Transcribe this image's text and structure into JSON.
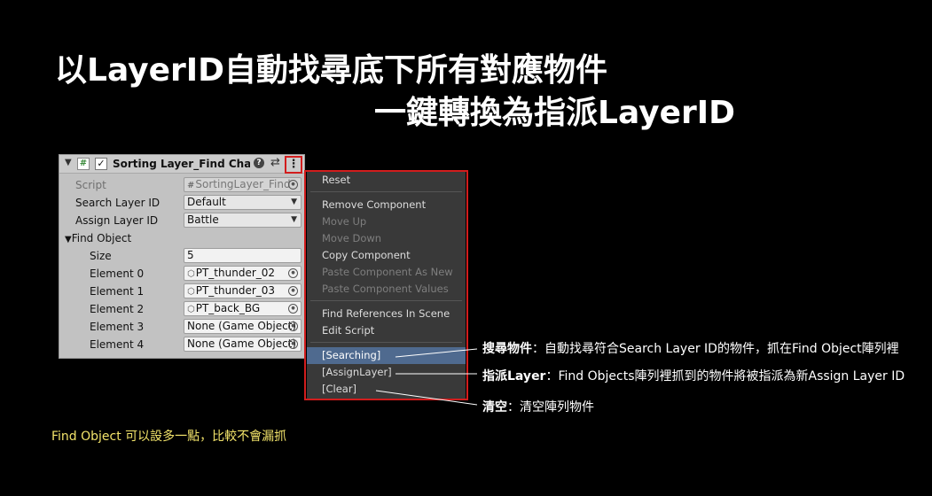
{
  "title": {
    "line1": "以LayerID自動找尋底下所有對應物件",
    "line2": "一鍵轉換為指派LayerID"
  },
  "inspector": {
    "component_name": "Sorting Layer_Find Change",
    "checkbox_mark": "✓",
    "script_label": "Script",
    "script_value": "SortingLayer_Find",
    "search_label": "Search Layer ID",
    "search_value": "Default",
    "assign_label": "Assign Layer ID",
    "assign_value": "Battle",
    "find_object_label": "Find Object",
    "size_label": "Size",
    "size_value": "5",
    "elements": [
      {
        "label": "Element 0",
        "value": "PT_thunder_02",
        "icon": "gameobject-icon"
      },
      {
        "label": "Element 1",
        "value": "PT_thunder_03",
        "icon": "gameobject-icon"
      },
      {
        "label": "Element 2",
        "value": "PT_back_BG",
        "icon": "gameobject-icon"
      },
      {
        "label": "Element 3",
        "value": "None (Game Object)",
        "icon": ""
      },
      {
        "label": "Element 4",
        "value": "None (Game Object)",
        "icon": ""
      }
    ]
  },
  "context_menu": {
    "items": [
      {
        "label": "Reset",
        "state": "enabled"
      },
      {
        "label": "Remove Component",
        "state": "enabled"
      },
      {
        "label": "Move Up",
        "state": "disabled"
      },
      {
        "label": "Move Down",
        "state": "disabled"
      },
      {
        "label": "Copy Component",
        "state": "enabled"
      },
      {
        "label": "Paste Component As New",
        "state": "disabled"
      },
      {
        "label": "Paste Component Values",
        "state": "disabled"
      },
      {
        "label": "Find References In Scene",
        "state": "enabled"
      },
      {
        "label": "Edit Script",
        "state": "enabled"
      },
      {
        "label": "[Searching]",
        "state": "selected"
      },
      {
        "label": "[AssignLayer]",
        "state": "enabled"
      },
      {
        "label": "[Clear]",
        "state": "enabled"
      }
    ]
  },
  "annotations": {
    "searching": {
      "term": "搜尋物件",
      "desc": "：自動找尋符合Search Layer ID的物件，抓在Find Object陣列裡"
    },
    "assign": {
      "term": "指派Layer",
      "desc": "：Find Objects陣列裡抓到的物件將被指派為新Assign Layer ID"
    },
    "clear": {
      "term": "清空",
      "desc": "：清空陣列物件"
    }
  },
  "footnote": "Find Object 可以設多一點，比較不會漏抓",
  "colors": {
    "background": "#000000",
    "highlight_red": "#d21d1d",
    "footnote_yellow": "#f2e36a",
    "menu_bg": "#393939",
    "menu_selected": "#4f6a8f"
  }
}
